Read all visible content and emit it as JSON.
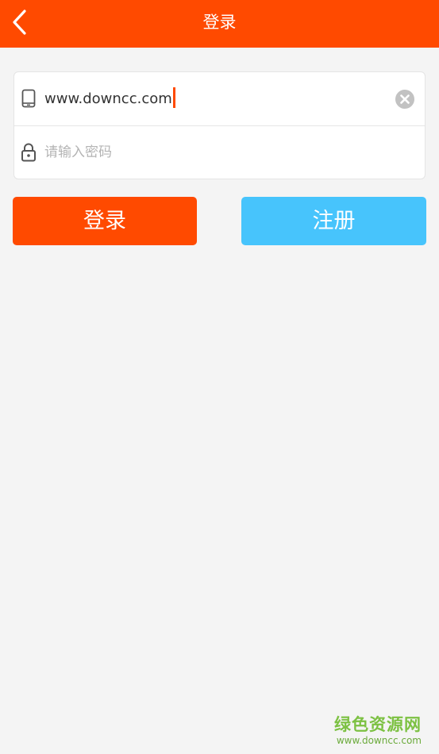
{
  "header": {
    "title": "登录",
    "back_icon": "chevron-left-icon",
    "background_color": "#ff4a00"
  },
  "form": {
    "account": {
      "icon": "phone-icon",
      "value": "www.downcc.com",
      "clear_icon": "clear-circle-icon"
    },
    "password": {
      "icon": "lock-icon",
      "placeholder": "请输入密码",
      "value": ""
    }
  },
  "buttons": {
    "login_label": "登录",
    "login_color": "#ff4a00",
    "register_label": "注册",
    "register_color": "#47c4fc"
  },
  "watermark": {
    "title": "绿色资源网",
    "url": "www.downcc.com"
  }
}
